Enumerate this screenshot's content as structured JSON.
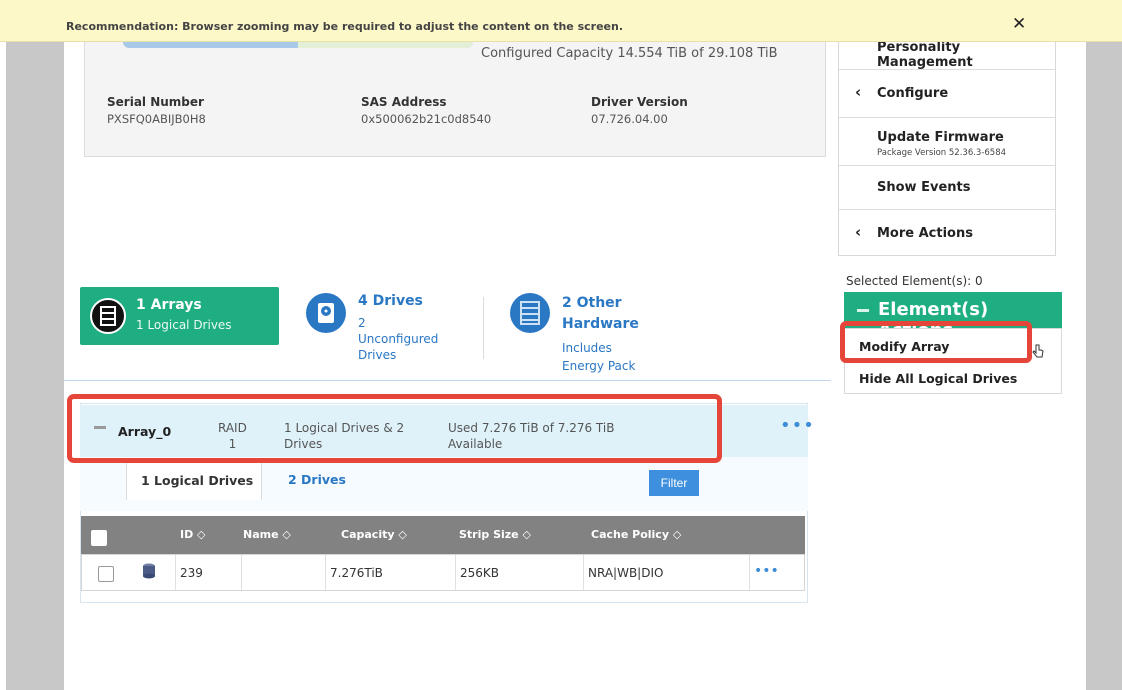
{
  "banner": {
    "text": "Recommendation: Browser zooming may be required to adjust the content on the screen.",
    "close_glyph": "✕"
  },
  "controller_card": {
    "capacity_text": "Configured Capacity 14.554 TiB of 29.108 TiB",
    "serial_label": "Serial Number",
    "serial_value": "PXSFQ0ABIJB0H8",
    "sas_label": "SAS Address",
    "sas_value": "0x500062b21c0d8540",
    "driver_label": "Driver Version",
    "driver_value": "07.726.04.00"
  },
  "actions_panel": {
    "personality": "Personality Management",
    "configure": "Configure",
    "configure_chevron": "‹",
    "update_firmware": "Update Firmware",
    "package_version": "Package Version 52.36.3-6584",
    "show_events": "Show Events",
    "more_actions": "More Actions",
    "more_chevron": "‹"
  },
  "selection": {
    "count_text": "Selected Element(s): 0",
    "header": "Element(s) Actions",
    "items": [
      "Modify Array",
      "Hide All Logical Drives"
    ]
  },
  "summary_tabs": {
    "arrays_title": "1 Arrays",
    "arrays_sub": "1 Logical Drives",
    "drives_title": "4 Drives",
    "drives_sub": "2\nUnconfigured\nDrives",
    "other_title": "2 Other\nHardware",
    "other_sub": "Includes\nEnergy Pack"
  },
  "array": {
    "name": "Array_0",
    "raid": "RAID\n1",
    "composition": "1 Logical Drives & 2\nDrives",
    "usage": "Used 7.276 TiB of 7.276 TiB\nAvailable",
    "more": "•••",
    "subtabs": [
      "1 Logical Drives",
      "2 Drives"
    ],
    "filter_label": "Filter"
  },
  "table": {
    "columns": [
      "ID ◇",
      "Name ◇",
      "Capacity ◇",
      "Strip Size ◇",
      "Cache Policy ◇"
    ],
    "rows": [
      {
        "id": "239",
        "name": "",
        "capacity": "7.276TiB",
        "strip": "256KB",
        "cache": "NRA|WB|DIO",
        "more": "•••"
      }
    ]
  },
  "colors": {
    "accent_green": "#1fad82",
    "link_blue": "#2a77c4",
    "highlight_red": "#e6453a",
    "banner_yellow": "#fdf8c8"
  }
}
